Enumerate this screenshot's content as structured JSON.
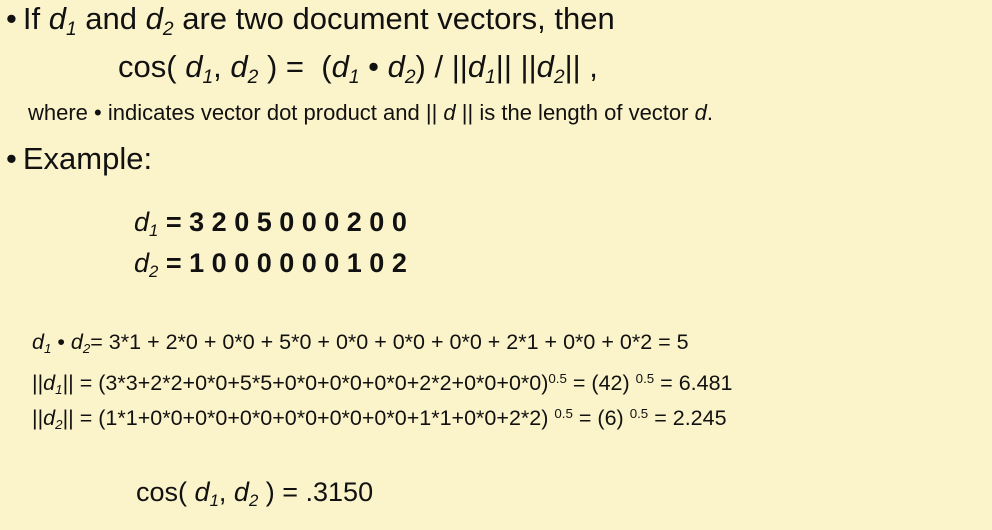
{
  "slide": {
    "bullet_char": "•",
    "line1": {
      "pre": "If",
      "d": "d",
      "s1": "1",
      "and": "and",
      "s2": "2",
      "post": "are two document vectors, then"
    },
    "formula": {
      "cos_open": "cos(",
      "d": "d",
      "s1": "1",
      "s2": "2",
      "comma": ",",
      "close_eq": ") =",
      "lparen": "(",
      "dot": "•",
      "rparen_slash": ") /",
      "bars": "||",
      "trailing_comma": ","
    },
    "where": {
      "text1": "where",
      "dot": "•",
      "text2": "indicates vector dot product and",
      "bars": "||",
      "d": "d",
      "text3": "is  the   length of vector",
      "end": "."
    },
    "example_label": "Example:",
    "vectors": {
      "d": "d",
      "s1": "1",
      "s2": "2",
      "eq": "=",
      "d1_values": "3 2 0 5 0 0 0 2 0 0",
      "d2_values": "1 0 0 0 0 0 0 1 0 2"
    },
    "dot_product": {
      "d": "d",
      "s1": "1",
      "s2": "2",
      "dot": "•",
      "expr": "=  3*1 + 2*0 + 0*0 + 5*0 + 0*0 + 0*0 + 0*0 + 2*1 + 0*0 + 0*2 = 5"
    },
    "norm1": {
      "bars_open": "||",
      "d": "d",
      "s1": "1",
      "bars_close": "||",
      "expr": "= (3*3+2*2+0*0+5*5+0*0+0*0+0*0+2*2+0*0+0*0)",
      "exp": "0.5",
      "mid": "=  (42)",
      "result": "= 6.481"
    },
    "norm2": {
      "bars_open": "||",
      "d": "d",
      "s2": "2",
      "bars_close": "||",
      "expr": "= (1*1+0*0+0*0+0*0+0*0+0*0+0*0+1*1+0*0+2*2)",
      "exp": "0.5",
      "mid": "= (6)",
      "result": "= 2.245"
    },
    "result": {
      "cos_open": "cos(",
      "d": "d",
      "s1": "1",
      "s2": "2",
      "comma": ",",
      "tail": ") = .3150"
    }
  }
}
